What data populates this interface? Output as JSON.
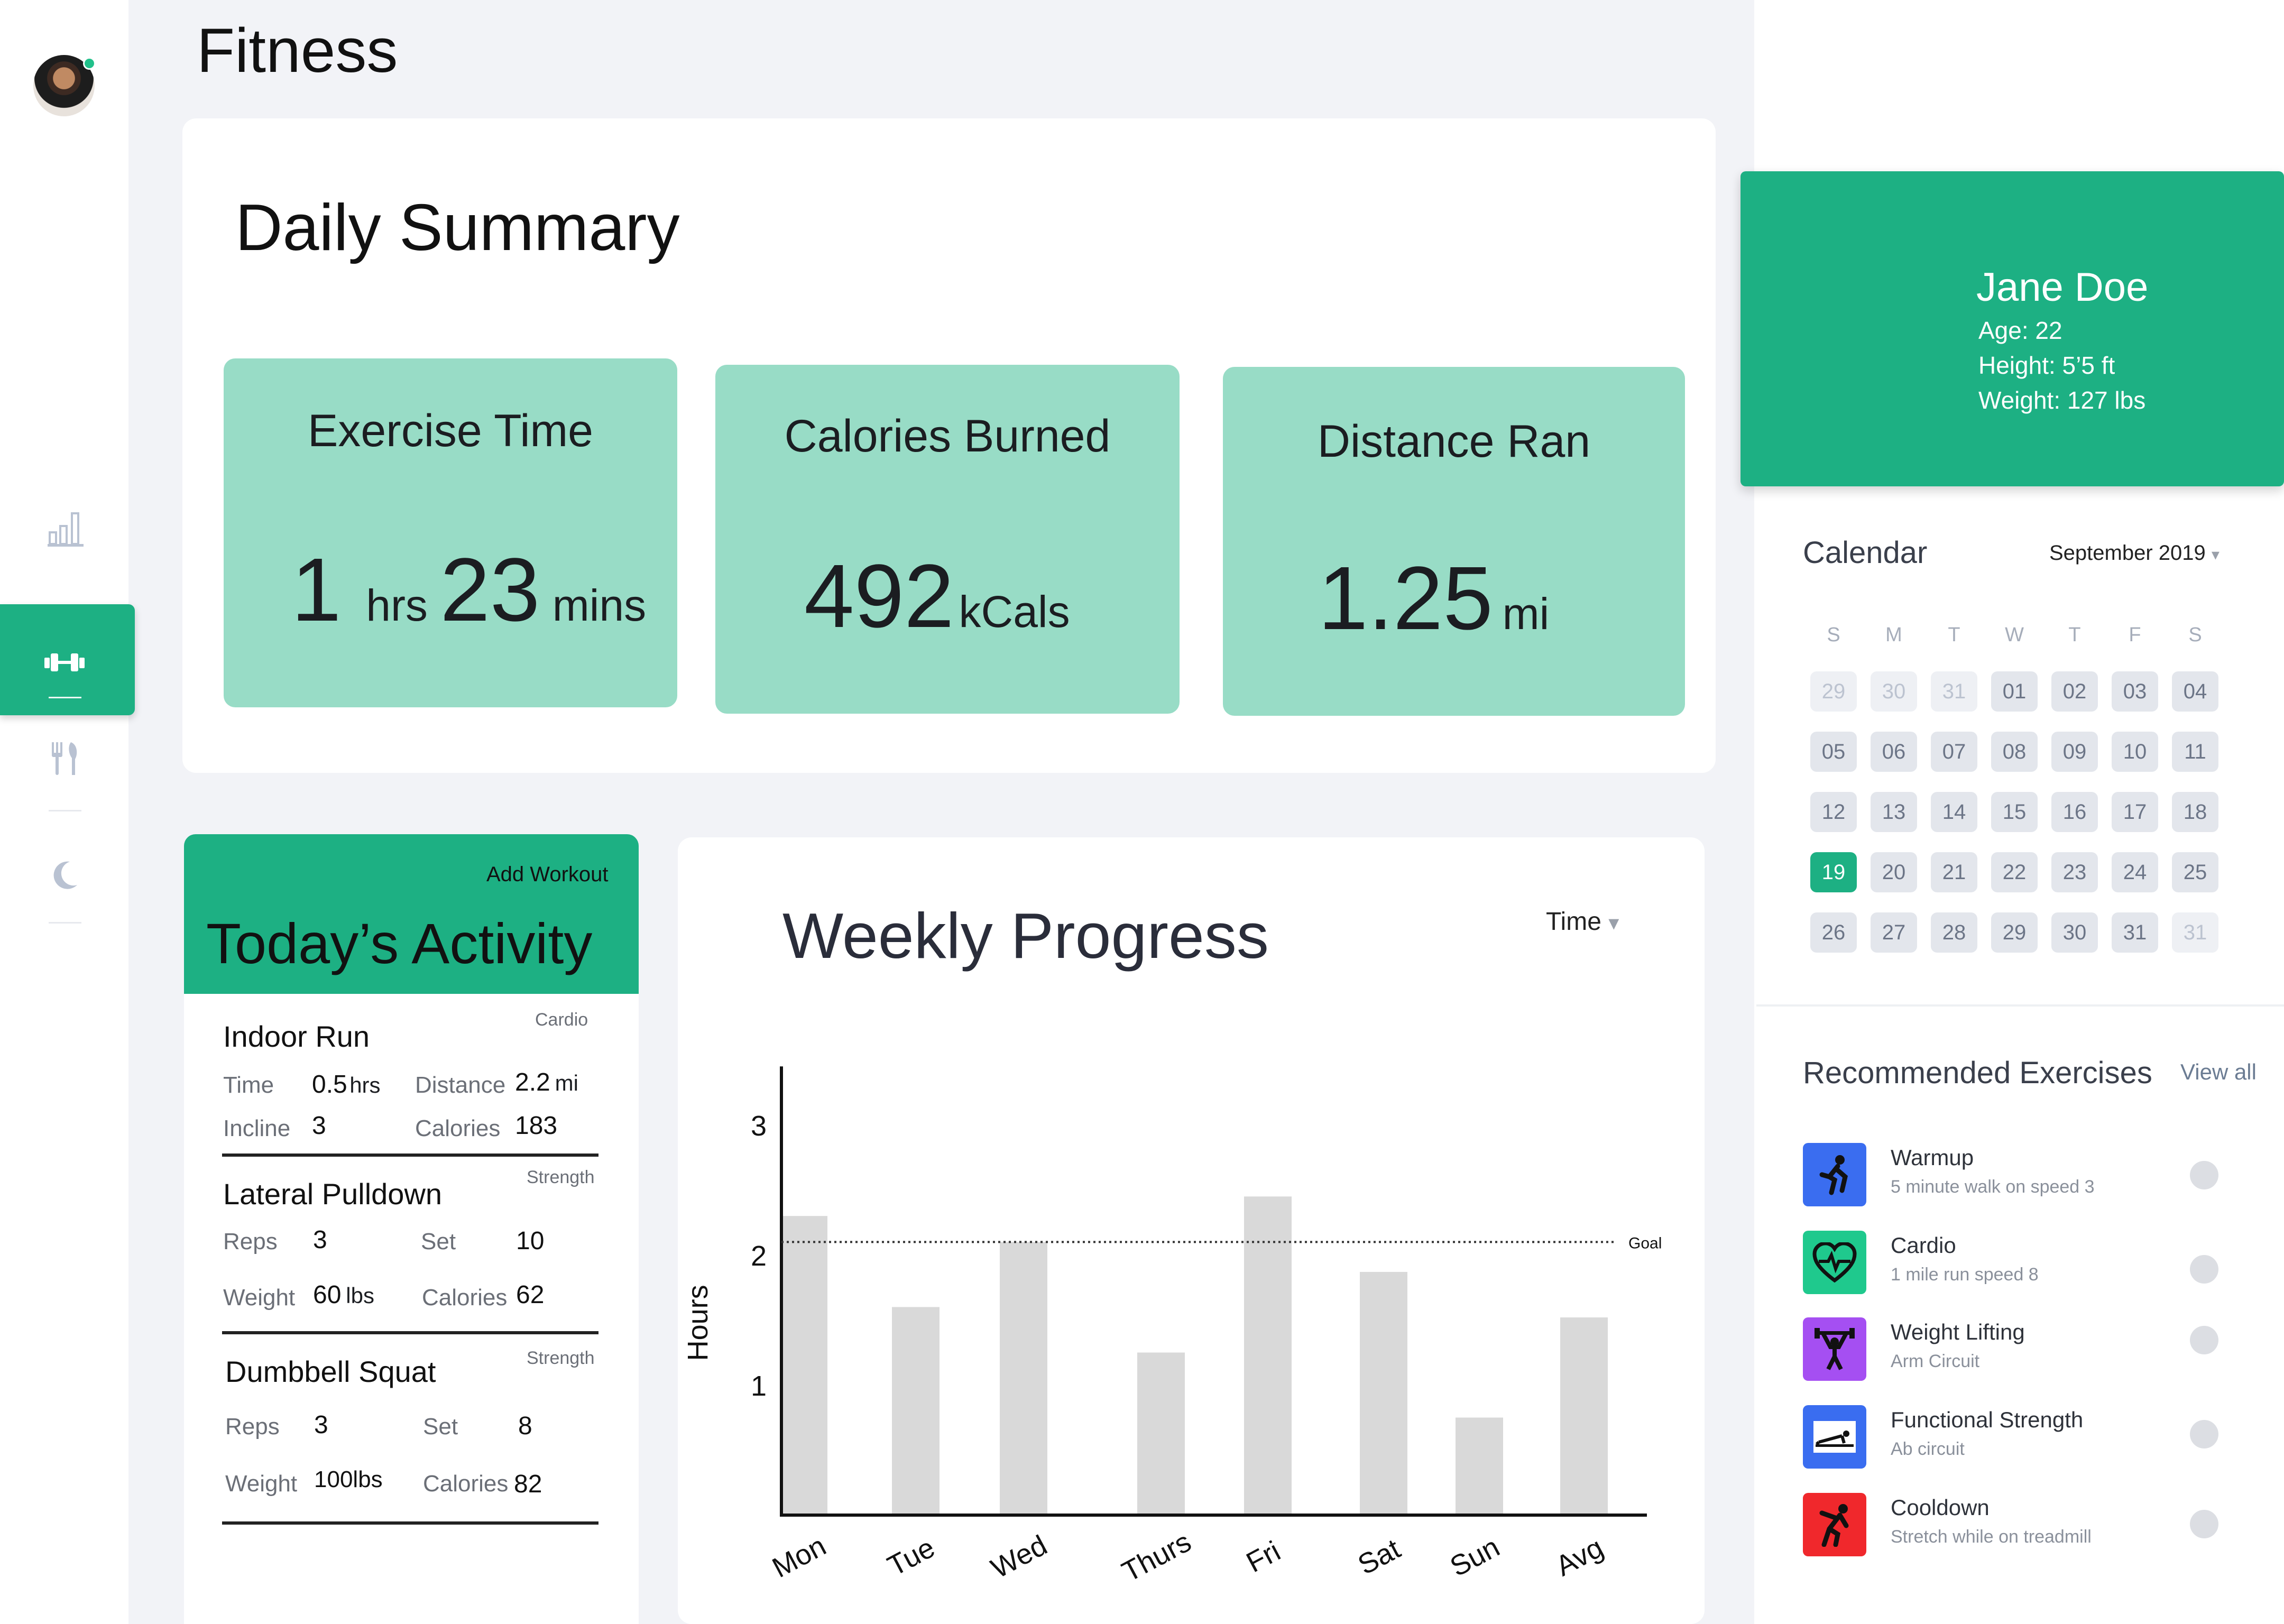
{
  "page_title": "Fitness",
  "daily_summary": {
    "title": "Daily Summary",
    "exercise_time": {
      "title": "Exercise Time",
      "hours": "1",
      "hours_unit": "hrs",
      "minutes": "23",
      "minutes_unit": "mins"
    },
    "calories": {
      "title": "Calories Burned",
      "value": "492",
      "unit": "kCals"
    },
    "distance": {
      "title": "Distance Ran",
      "value": "1.25",
      "unit": "mi"
    }
  },
  "activity": {
    "add_label": "Add Workout",
    "title": "Today’s Activity",
    "items": [
      {
        "name": "Indoor Run",
        "category": "Cardio",
        "f1_label": "Time",
        "f1_value": "0.5",
        "f1_unit": "hrs",
        "f2_label": "Distance",
        "f2_value": "2.2",
        "f2_unit": "mi",
        "f3_label": "Incline",
        "f3_value": "3",
        "f4_label": "Calories",
        "f4_value": "183"
      },
      {
        "name": "Lateral Pulldown",
        "category": "Strength",
        "f1_label": "Reps",
        "f1_value": "3",
        "f2_label": "Set",
        "f2_value": "10",
        "f3_label": "Weight",
        "f3_value": "60",
        "f3_unit": "lbs",
        "f4_label": "Calories",
        "f4_value": "62"
      },
      {
        "name": "Dumbbell Squat",
        "category": "Strength",
        "f1_label": "Reps",
        "f1_value": "3",
        "f2_label": "Set",
        "f2_value": "8",
        "f3_label": "Weight",
        "f3_value": "100lbs",
        "f4_label": "Calories",
        "f4_value": "82"
      }
    ]
  },
  "weekly": {
    "title": "Weekly Progress",
    "dropdown": "Time",
    "chart_data": {
      "type": "bar",
      "categories": [
        "Mon",
        "Tue",
        "Wed",
        "Thurs",
        "Fri",
        "Sat",
        "Sun",
        "Avg"
      ],
      "values": [
        2.3,
        1.6,
        2.1,
        1.25,
        2.45,
        1.87,
        0.75,
        1.52
      ],
      "ylabel": "Hours",
      "yticks": [
        1,
        2,
        3
      ],
      "ylim": [
        0,
        3.6
      ],
      "goal": 2.1,
      "goal_label": "Goal",
      "grid": false
    }
  },
  "profile": {
    "name": "Jane Doe",
    "age": "Age: 22",
    "height": "Height: 5’5 ft",
    "weight": "Weight: 127 lbs"
  },
  "calendar": {
    "title": "Calendar",
    "month": "September 2019",
    "weekdays": [
      "S",
      "M",
      "T",
      "W",
      "T",
      "F",
      "S"
    ],
    "weeks": [
      [
        "29",
        "30",
        "31",
        "01",
        "02",
        "03",
        "04"
      ],
      [
        "05",
        "06",
        "07",
        "08",
        "09",
        "10",
        "11"
      ],
      [
        "12",
        "13",
        "14",
        "15",
        "16",
        "17",
        "18"
      ],
      [
        "19",
        "20",
        "21",
        "22",
        "23",
        "24",
        "25"
      ],
      [
        "26",
        "27",
        "28",
        "29",
        "30",
        "31",
        "31"
      ]
    ],
    "selected": "19"
  },
  "recommended": {
    "title": "Recommended Exercises",
    "view_all": "View all",
    "items": [
      {
        "name": "Warmup",
        "sub": "5 minute walk  on speed 3",
        "color": "#3a6df0",
        "icon": "walk-icon"
      },
      {
        "name": "Cardio",
        "sub": "1 mile run speed 8",
        "color": "#1fc98d",
        "icon": "heartbeat-icon"
      },
      {
        "name": "Weight Lifting",
        "sub": "Arm Circuit",
        "color": "#a54ff2",
        "icon": "weightlifter-icon"
      },
      {
        "name": "Functional Strength",
        "sub": "Ab circuit",
        "color": "#3a6df0",
        "icon": "plank-icon"
      },
      {
        "name": "Cooldown",
        "sub": "Stretch while on treadmill",
        "color": "#f0282c",
        "icon": "stretch-icon"
      }
    ]
  },
  "colors": {
    "accent": "#1db083",
    "stat_card": "#98dcc6"
  }
}
